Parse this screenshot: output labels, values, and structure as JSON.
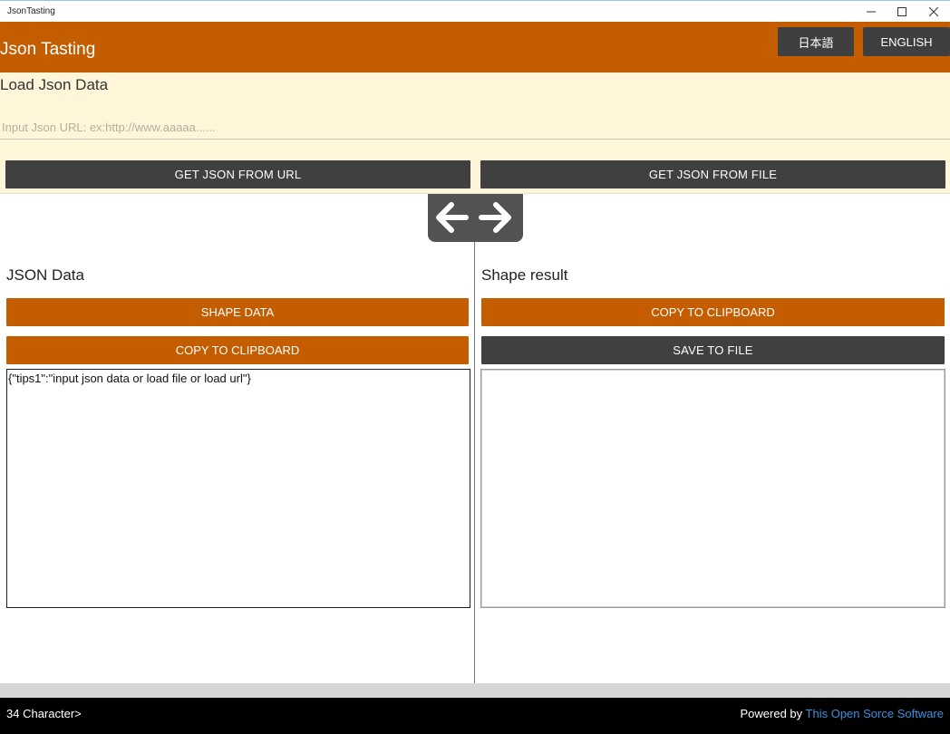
{
  "window": {
    "title": "JsonTasting",
    "minimize_icon": "minimize-icon",
    "maximize_icon": "maximize-icon",
    "close_icon": "close-icon"
  },
  "header": {
    "app_title": "Json Tasting",
    "lang_ja": "日本語",
    "lang_en": "ENGLISH",
    "accent_color": "#c45c00"
  },
  "load": {
    "heading": "Load Json Data",
    "url_placeholder": "Input Json URL: ex:http://www.aaaaa......",
    "url_value": "",
    "get_from_url": "GET JSON FROM URL",
    "get_from_file": "GET JSON FROM FILE",
    "panel_color": "#fff6d9"
  },
  "swap": {
    "left_icon": "arrow-left-icon",
    "right_icon": "arrow-right-icon"
  },
  "json_pane": {
    "title": "JSON Data",
    "shape_button": "SHAPE DATA",
    "copy_button": "COPY TO CLIPBOARD",
    "content": "{\"tips1\":\"input json data or load file or load url\"}"
  },
  "result_pane": {
    "title": "Shape result",
    "copy_button": "COPY TO CLIPBOARD",
    "save_button": "SAVE TO FILE",
    "content": ""
  },
  "status": {
    "char_count": "34 Character>",
    "powered_prefix": "Powered by ",
    "powered_link": "This Open Sorce Software"
  }
}
